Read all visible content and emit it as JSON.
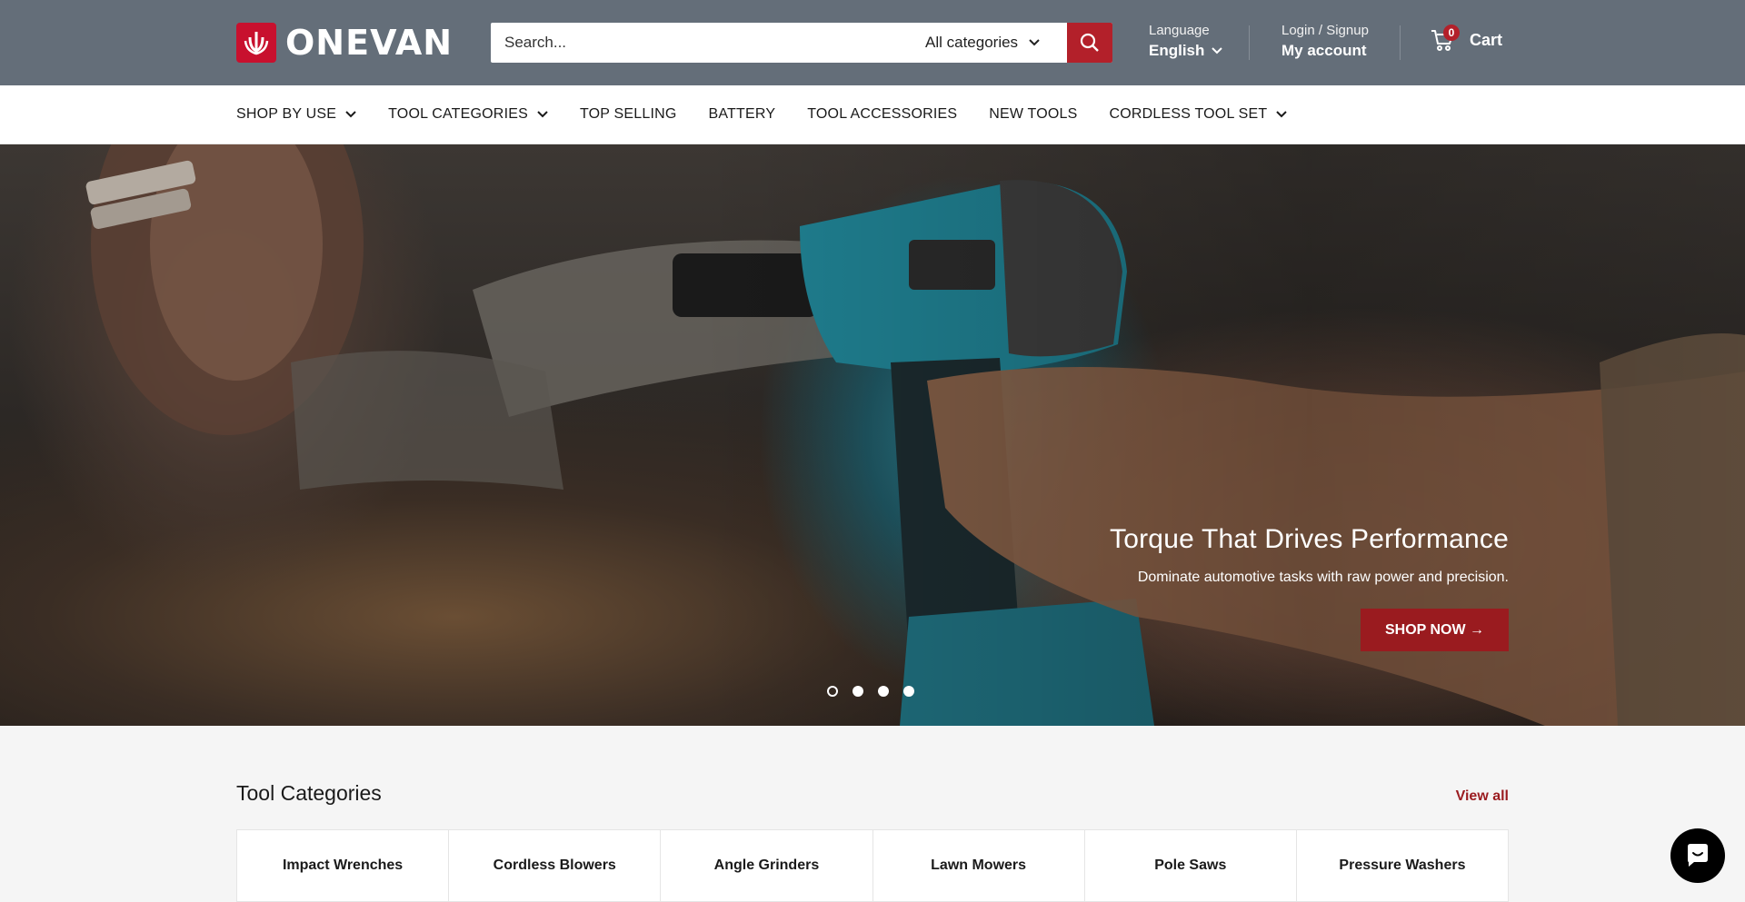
{
  "brand": {
    "name": "ONEVAN",
    "accent": "#b3202a",
    "header_bg": "#646e79"
  },
  "search": {
    "placeholder": "Search...",
    "category": "All categories"
  },
  "language": {
    "label": "Language",
    "value": "English"
  },
  "account": {
    "label": "Login / Signup",
    "value": "My account"
  },
  "cart": {
    "count": "0",
    "label": "Cart"
  },
  "nav": {
    "items": [
      {
        "label": "SHOP BY USE"
      },
      {
        "label": "TOOL CATEGORIES"
      },
      {
        "label": "TOP SELLING"
      },
      {
        "label": "BATTERY"
      },
      {
        "label": "TOOL ACCESSORIES"
      },
      {
        "label": "NEW TOOLS"
      },
      {
        "label": "CORDLESS TOOL SET"
      }
    ]
  },
  "hero": {
    "title": "Torque That Drives Performance",
    "subtitle": "Dominate automotive tasks with raw power and precision.",
    "cta": "SHOP NOW →"
  },
  "categories": {
    "title": "Tool Categories",
    "view_all": "View all",
    "items": [
      "Impact Wrenches",
      "Cordless Blowers",
      "Angle Grinders",
      "Lawn Mowers",
      "Pole Saws",
      "Pressure Washers"
    ]
  }
}
